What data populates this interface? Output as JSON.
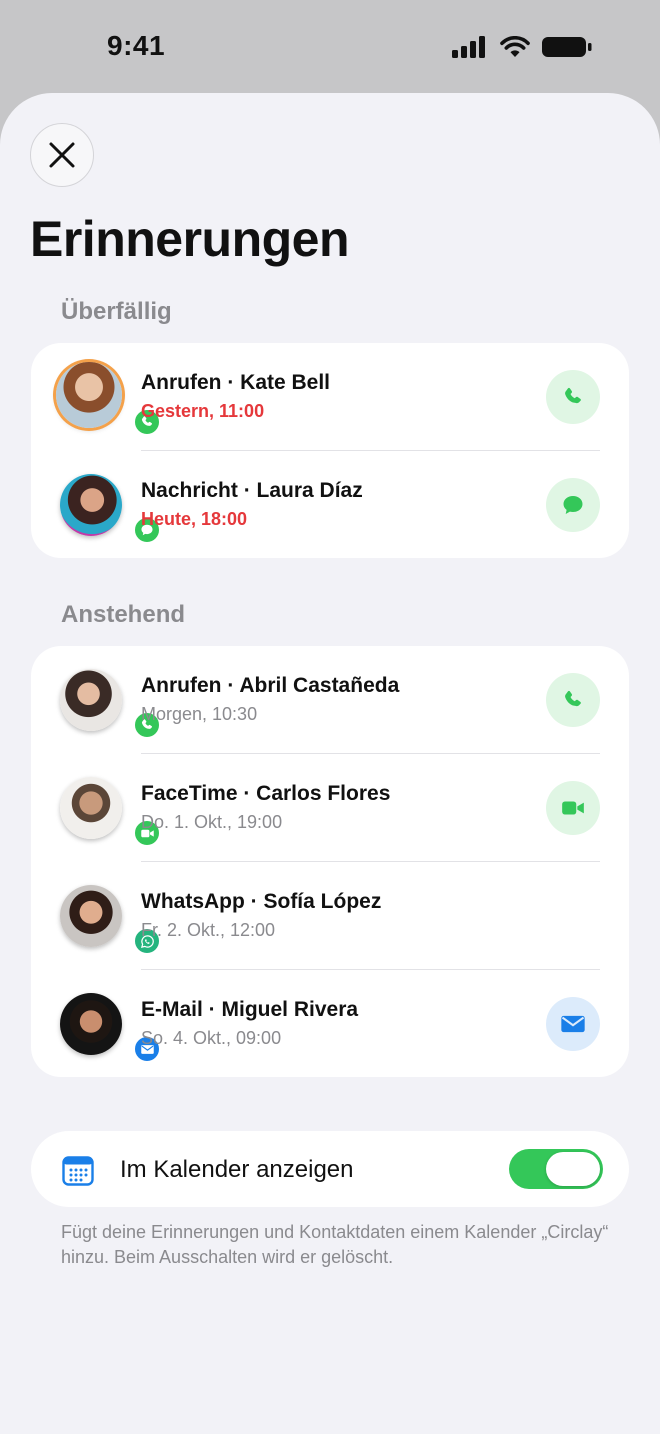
{
  "status_bar": {
    "time": "9:41"
  },
  "page": {
    "title": "Erinnerungen"
  },
  "overdue": {
    "label": "Überfällig",
    "items": [
      {
        "title": "Anrufen · Kate Bell",
        "time": "Gestern, 11:00",
        "badge_icon": "phone-icon",
        "action_icon": "phone-icon"
      },
      {
        "title": "Nachricht · Laura Díaz",
        "time": "Heute, 18:00",
        "badge_icon": "message-icon",
        "action_icon": "message-icon"
      }
    ]
  },
  "upcoming": {
    "label": "Anstehend",
    "items": [
      {
        "title": "Anrufen · Abril Castañeda",
        "time": "Morgen, 10:30",
        "badge_icon": "phone-icon",
        "action_icon": "phone-icon"
      },
      {
        "title": "FaceTime · Carlos Flores",
        "time": "Do. 1. Okt., 19:00",
        "badge_icon": "video-icon",
        "action_icon": "video-icon"
      },
      {
        "title": "WhatsApp · Sofía López",
        "time": "Fr. 2. Okt., 12:00",
        "badge_icon": "whatsapp-icon",
        "action_icon": ""
      },
      {
        "title": "E-Mail · Miguel Rivera",
        "time": "So. 4. Okt., 09:00",
        "badge_icon": "mail-icon",
        "action_icon": "mail-icon"
      }
    ]
  },
  "calendar": {
    "label": "Im Kalender anzeigen",
    "enabled": true,
    "footnote": "Fügt deine Erinnerungen und Kontaktdaten einem Kalender „Circlay“ hinzu. Beim Ausschalten wird er gelöscht."
  },
  "colors": {
    "accent_green": "#34c759",
    "overdue_red": "#e5383b",
    "mail_blue": "#1a7fe8",
    "whatsapp_teal": "#25b47e",
    "avatar_ring": "#f4a14a"
  }
}
